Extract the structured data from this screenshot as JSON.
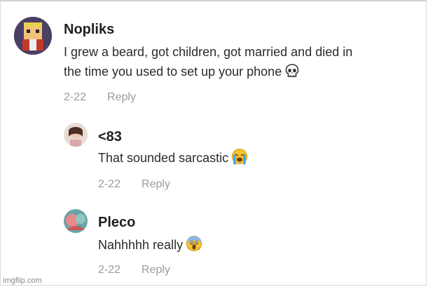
{
  "comments": [
    {
      "username": "Nopliks",
      "text_line1": "I grew a beard, got children, got married and died in",
      "text_line2": "the time you used to set up your phone",
      "emoji": "skull-icon",
      "date": "2-22",
      "reply_label": "Reply"
    },
    {
      "username": "<83",
      "text": "That sounded sarcastic",
      "emoji": "crying-face-icon",
      "date": "2-22",
      "reply_label": "Reply"
    },
    {
      "username": "Pleco",
      "text": "Nahhhhh really",
      "emoji": "screaming-face-icon",
      "date": "2-22",
      "reply_label": "Reply"
    }
  ],
  "watermark": "imgflip.com"
}
